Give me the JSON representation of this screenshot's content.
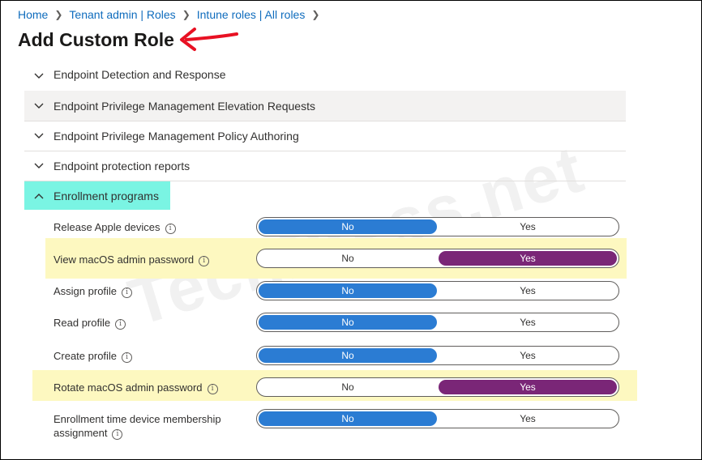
{
  "breadcrumb": [
    "Home",
    "Tenant admin | Roles",
    "Intune roles | All roles"
  ],
  "title": "Add Custom Role",
  "watermark": "TechPress.net",
  "sections": [
    {
      "label": "Endpoint Detection and Response",
      "expanded": false
    },
    {
      "label": "Endpoint Privilege Management Elevation Requests",
      "expanded": false,
      "hovered": true
    },
    {
      "label": "Endpoint Privilege Management Policy Authoring",
      "expanded": false
    },
    {
      "label": "Endpoint protection reports",
      "expanded": false
    },
    {
      "label": "Enrollment programs",
      "expanded": true
    }
  ],
  "toggle_options": {
    "no": "No",
    "yes": "Yes"
  },
  "permissions": [
    {
      "label": "Release Apple devices",
      "value": "No"
    },
    {
      "label": "View macOS admin password",
      "value": "Yes"
    },
    {
      "label": "Assign profile",
      "value": "No"
    },
    {
      "label": "Read profile",
      "value": "No"
    },
    {
      "label": "Create profile",
      "value": "No"
    },
    {
      "label": "Rotate macOS admin password",
      "value": "Yes"
    },
    {
      "label_line1": "Enrollment time device membership",
      "label_line2": "assignment",
      "value": "No"
    }
  ],
  "colors": {
    "selected_no": "#2b7cd3",
    "selected_yes": "#7a2677",
    "highlight_yellow": "#fdf8c0",
    "highlight_cyan": "#7af4e3",
    "annotation_arrow": "#e81123"
  }
}
